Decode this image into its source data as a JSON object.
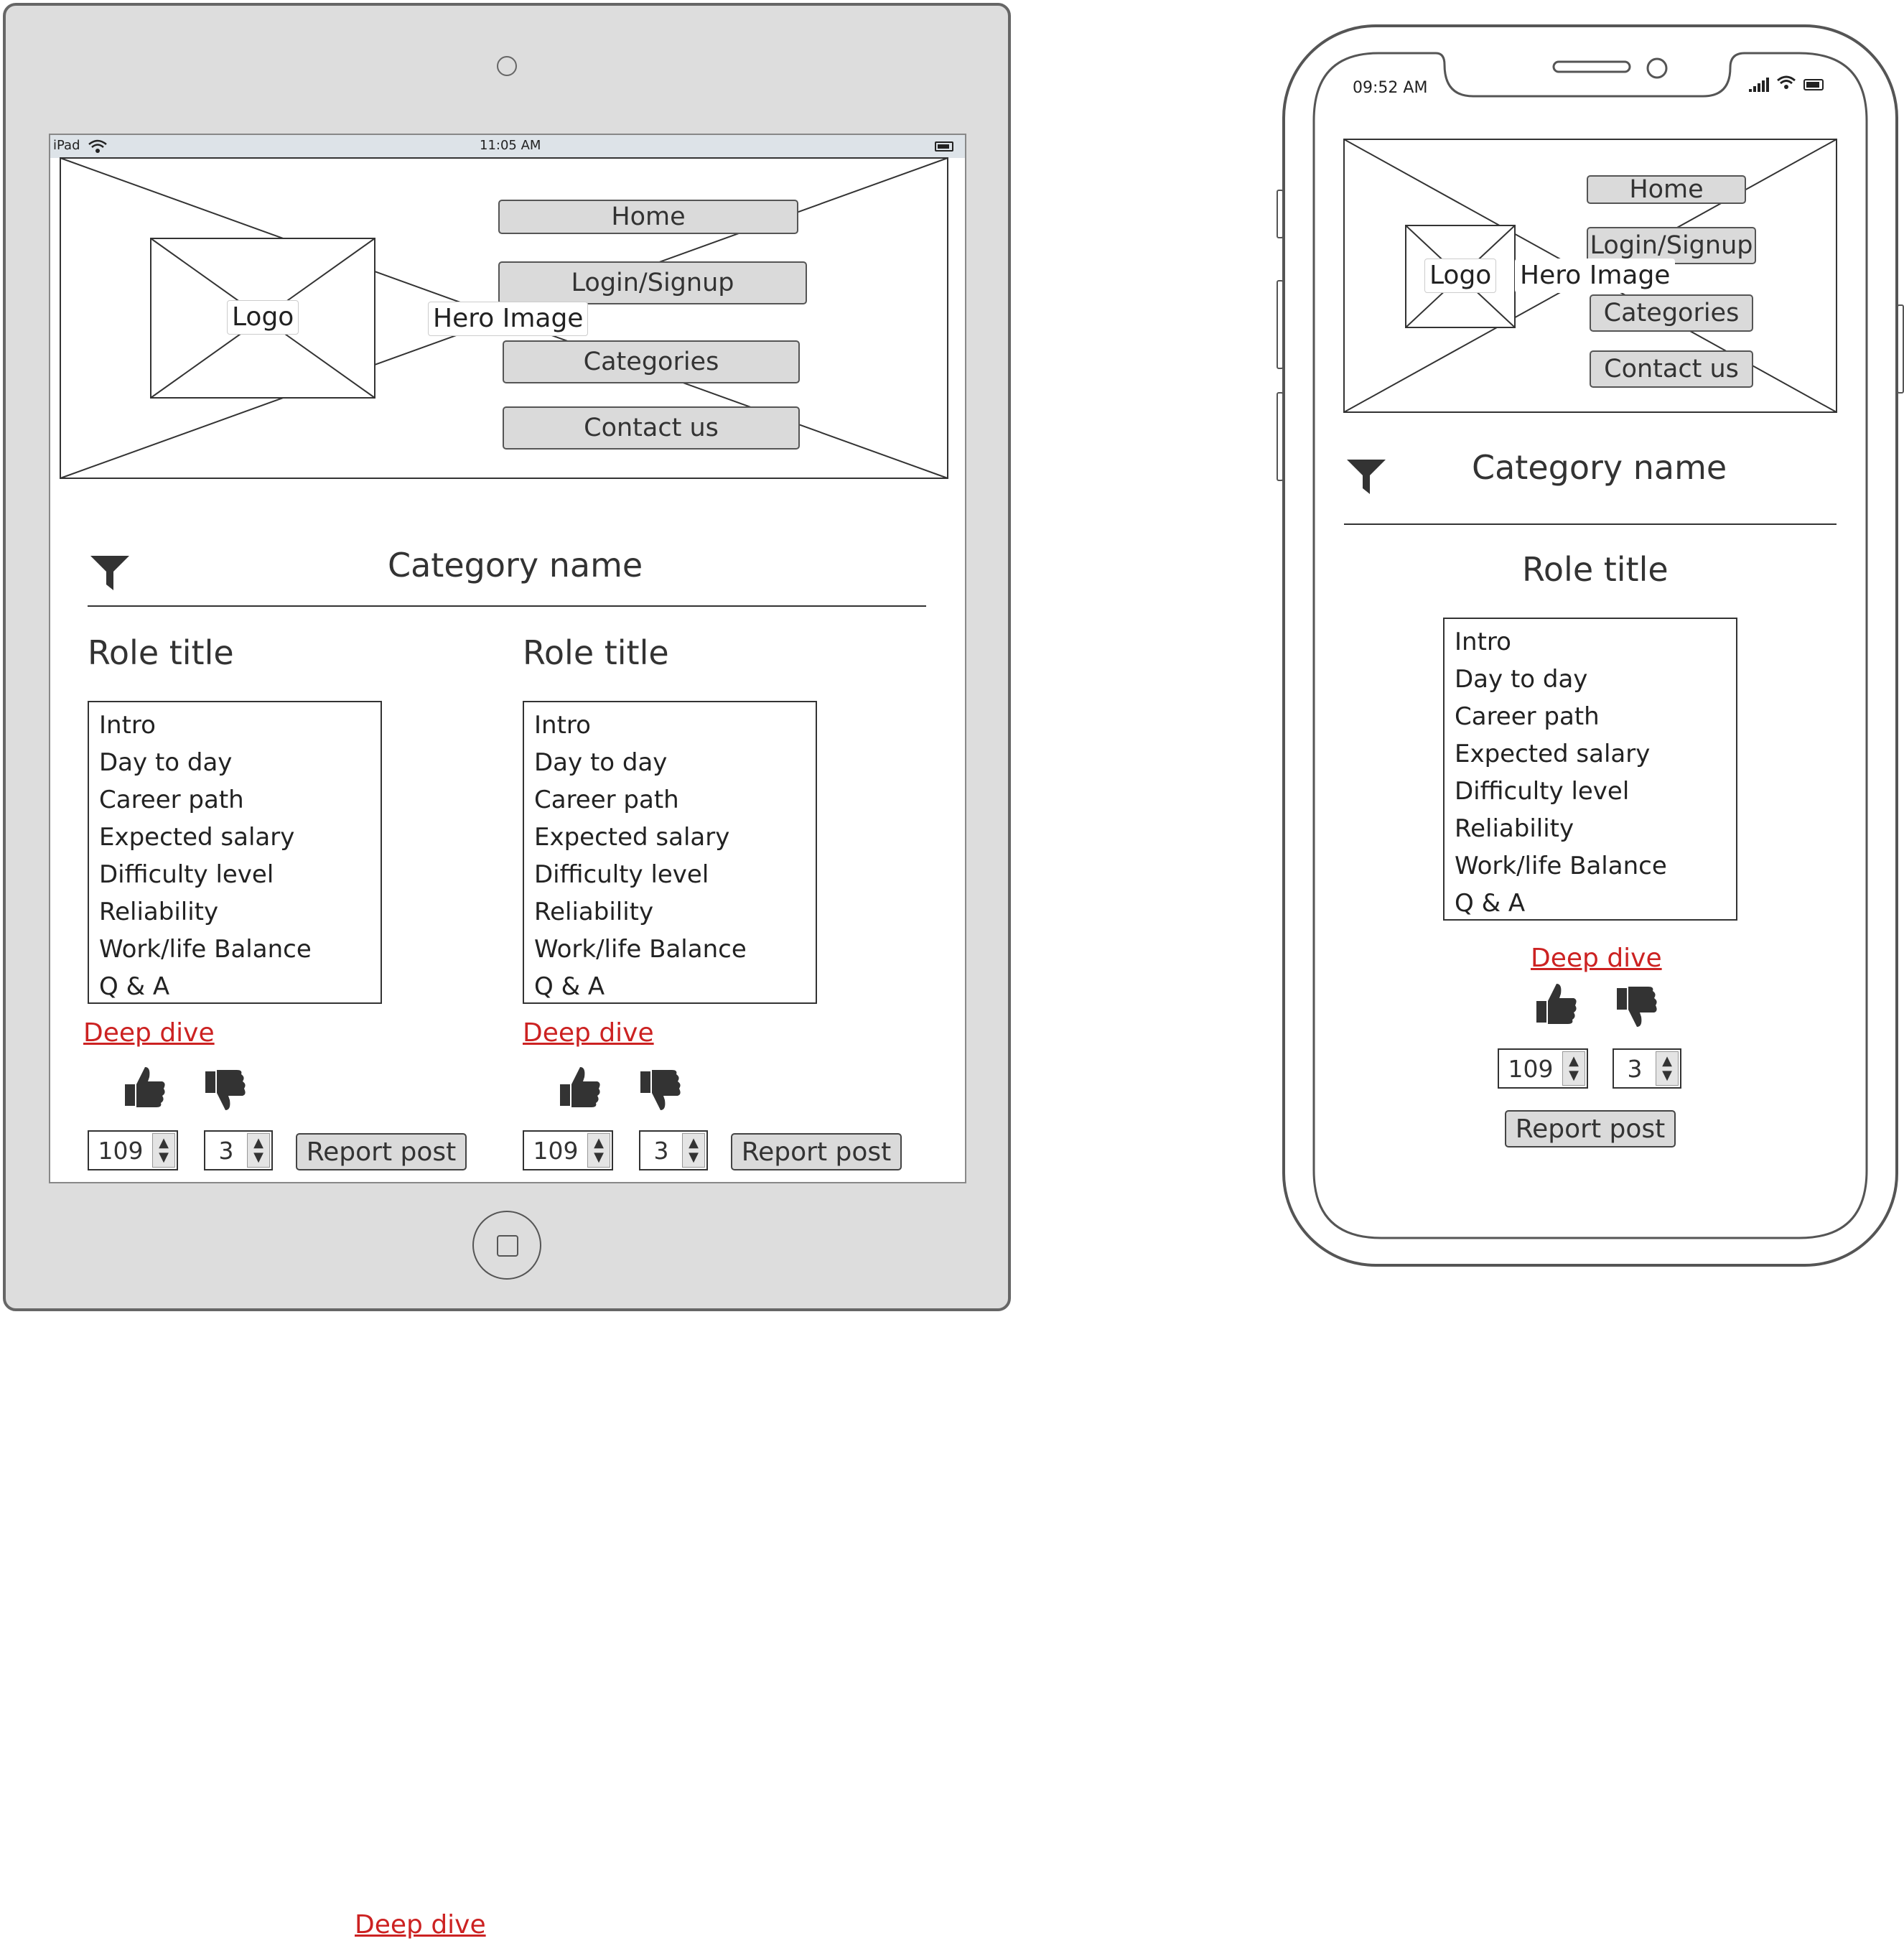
{
  "tablet": {
    "status_bar": {
      "device": "iPad",
      "time": "11:05 AM"
    },
    "header": {
      "logo_label": "Logo",
      "hero_label": "Hero Image",
      "nav": [
        "Home",
        "Login/Signup",
        "Categories",
        "Contact us"
      ]
    },
    "filter_icon": "filter-icon",
    "category_name": "Category name",
    "cards": [
      {
        "role_title": "Role title",
        "list": [
          "Intro",
          "Day to day",
          "Career path",
          "Expected salary",
          "Difficulty level",
          "Reliability",
          "Work/life Balance",
          "Q & A"
        ],
        "deep_dive": "Deep dive",
        "upvotes": "109",
        "downvotes": "3",
        "report": "Report post"
      },
      {
        "role_title": "Role title",
        "list": [
          "Intro",
          "Day to day",
          "Career path",
          "Expected salary",
          "Difficulty level",
          "Reliability",
          "Work/life Balance",
          "Q & A"
        ],
        "deep_dive": "Deep dive",
        "upvotes": "109",
        "downvotes": "3",
        "report": "Report post"
      }
    ]
  },
  "phone": {
    "status_bar": {
      "time": "09:52 AM"
    },
    "header": {
      "logo_label": "Logo",
      "hero_label": "Hero Image",
      "nav": [
        "Home",
        "Login/Signup",
        "Categories",
        "Contact us"
      ]
    },
    "filter_icon": "filter-icon",
    "category_name": "Category name",
    "card": {
      "role_title": "Role title",
      "list": [
        "Intro",
        "Day to day",
        "Career path",
        "Expected salary",
        "Difficulty level",
        "Reliability",
        "Work/life Balance",
        "Q & A"
      ],
      "deep_dive": "Deep dive",
      "upvotes": "109",
      "downvotes": "3",
      "report": "Report post"
    }
  },
  "stray_link": "Deep dive",
  "colors": {
    "device_gray": "#dddddd",
    "link_red": "#cc2222",
    "button_gray": "#dadada"
  }
}
